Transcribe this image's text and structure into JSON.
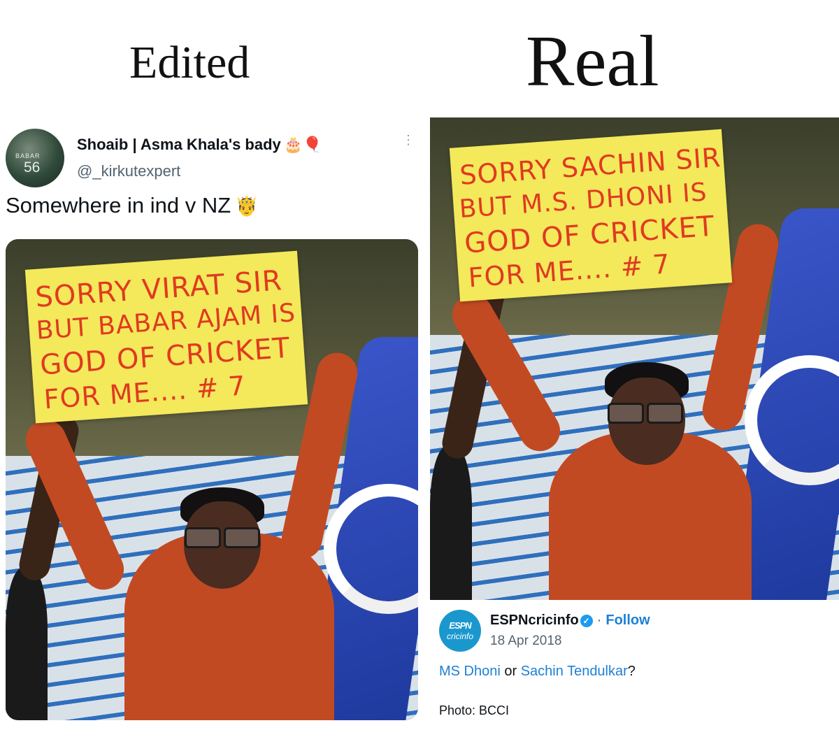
{
  "headings": {
    "left": "Edited",
    "right": "Real"
  },
  "tweet": {
    "display_name": "Shoaib | Asma Khala's bady",
    "name_emojis": "🎂🎈",
    "handle": "@_kirkutexpert",
    "text": "Somewhere in ind v NZ",
    "text_emoji": "🤴",
    "more_icon": "⋮",
    "avatar_jersey_name": "BABAR",
    "avatar_jersey_number": "56",
    "sign_lines": [
      "SORRY VIRAT SIR",
      "BUT BABAR AJAM IS",
      "GOD OF CRICKET",
      "FOR ME.... # 7"
    ]
  },
  "real": {
    "sign_lines": [
      "SORRY SACHIN SIR",
      "BUT M.S. DHONI IS",
      "GOD OF CRICKET",
      "FOR ME.... # 7"
    ],
    "espn": {
      "logo_top": "ESPN",
      "logo_bottom": "cricinfo",
      "account": "ESPNcricinfo",
      "verified_icon": "✓",
      "separator": "·",
      "follow": "Follow",
      "date": "18 Apr 2018",
      "question_link1": "MS Dhoni",
      "question_mid": " or ",
      "question_link2": "Sachin Tendulkar",
      "question_end": "?",
      "credit": "Photo: BCCI"
    }
  },
  "colors": {
    "sign": "#f3e95b",
    "sign_text": "#e03a20",
    "shirt": "#c24a22",
    "link": "#1d7fd6",
    "flag": "#2a46b8"
  }
}
